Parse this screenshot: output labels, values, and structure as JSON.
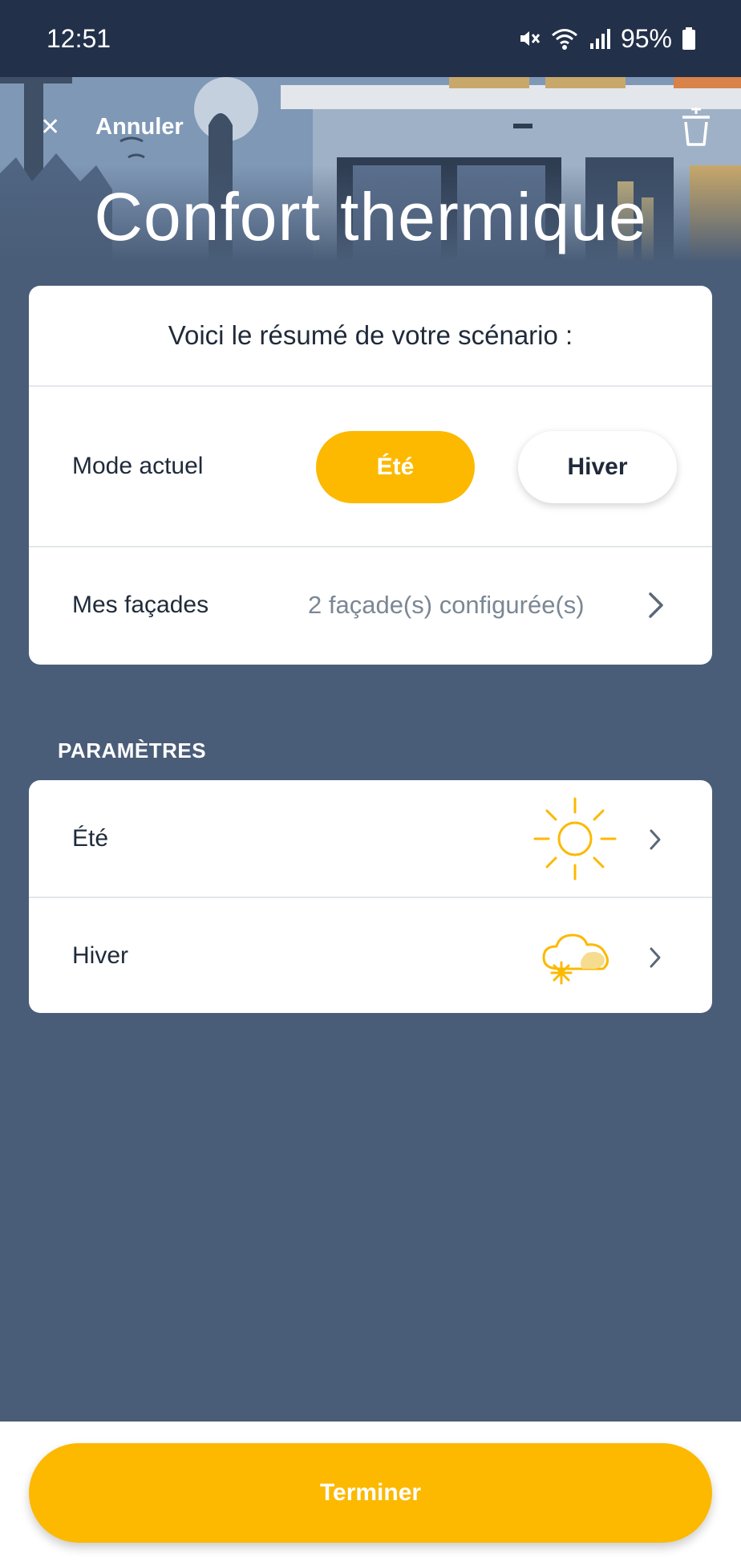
{
  "status_bar": {
    "time": "12:51",
    "battery": "95%",
    "icons": [
      "mute-icon",
      "wifi-icon",
      "signal-icon",
      "battery-icon"
    ]
  },
  "header": {
    "cancel_label": "Annuler",
    "close_icon": "close-icon",
    "trash_icon": "trash-icon",
    "title": "Confort thermique"
  },
  "summary": {
    "heading": "Voici le résumé de votre scénario :",
    "mode": {
      "label": "Mode actuel",
      "options": [
        "Été",
        "Hiver"
      ],
      "selected": "Été"
    },
    "facades": {
      "label": "Mes façades",
      "value": "2 façade(s) configurée(s)"
    }
  },
  "parameters": {
    "section_title": "PARAMÈTRES",
    "items": [
      {
        "label": "Été",
        "icon": "sun-icon"
      },
      {
        "label": "Hiver",
        "icon": "snow-cloud-icon"
      }
    ]
  },
  "footer": {
    "finish_label": "Terminer"
  },
  "colors": {
    "accent": "#fcb900",
    "background": "#4a5d78",
    "status_bar": "#22304a"
  }
}
